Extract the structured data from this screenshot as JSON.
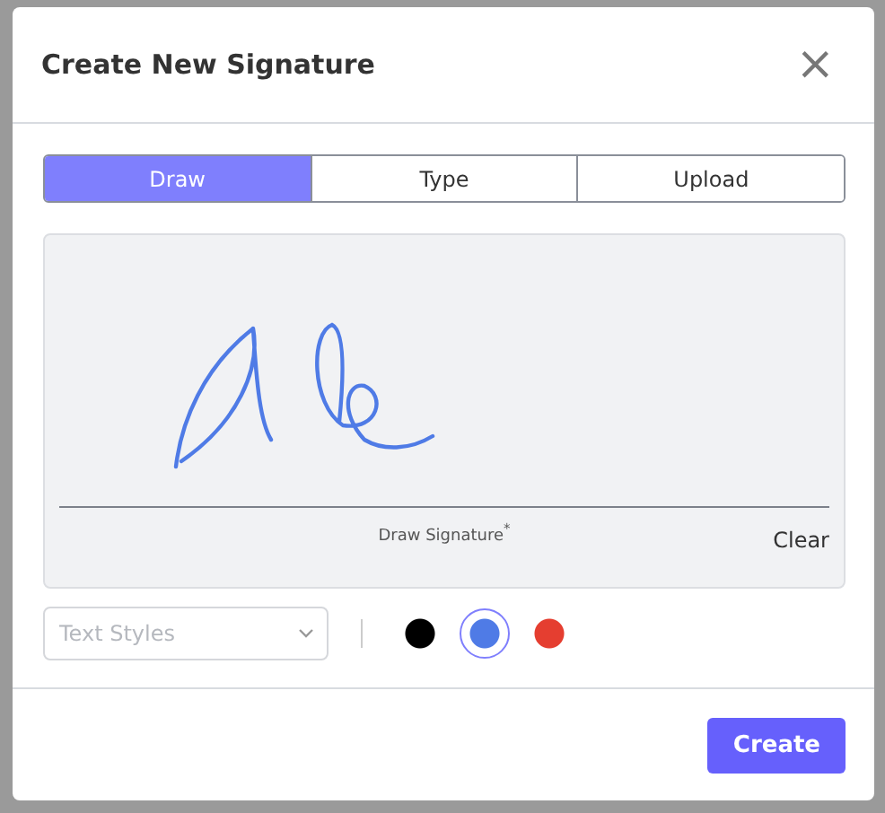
{
  "dialog": {
    "title": "Create New Signature",
    "close": "×"
  },
  "tabs": [
    {
      "label": "Draw",
      "selected": true
    },
    {
      "label": "Type",
      "selected": false
    },
    {
      "label": "Upload",
      "selected": false
    }
  ],
  "pad": {
    "caption": "Draw Signature$^{*}$",
    "clear": "Clear"
  },
  "text_styles": {
    "placeholder": "Text Styles"
  },
  "colors": [
    {
      "color": "#000000",
      "selected": false
    },
    {
      "color": "#4f7be6",
      "selected": true
    },
    {
      "color": "#e53e30",
      "selected": false
    }
  ],
  "buttons": [
    {
      "label": "Create"
    }
  ]
}
